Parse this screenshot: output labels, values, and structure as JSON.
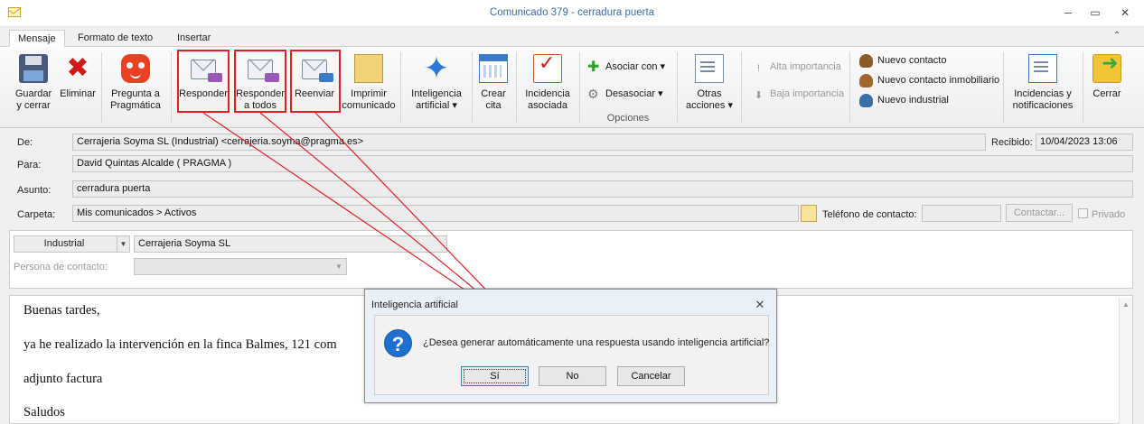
{
  "window": {
    "title": "Comunicado 379 - cerradura puerta",
    "controls": {
      "minimize": "─",
      "restore": "▭",
      "close": "✕"
    }
  },
  "tabs": [
    "Mensaje",
    "Formato de texto",
    "Insertar"
  ],
  "ribbon": {
    "buttons": {
      "guardar": "Guardar\ny cerrar",
      "eliminar": "Eliminar",
      "pregunta": "Pregunta a\nPragmática",
      "responder": "Responder",
      "responder_todos": "Responder\na todos",
      "reenviar": "Reenviar",
      "imprimir": "Imprimir\ncomunicado",
      "ia": "Inteligencia\nartificial ▾",
      "crear_cita": "Crear\ncita",
      "incidencia": "Incidencia\nasociada",
      "otras": "Otras\nacciones ▾",
      "incidencias_notif": "Incidencias y\nnotificaciones",
      "cerrar": "Cerrar"
    },
    "small": {
      "asociar": "Asociar con ▾",
      "desasociar": "Desasociar ▾",
      "alta": "Alta importancia",
      "baja": "Baja importancia",
      "nuevo_contacto": "Nuevo contacto",
      "nuevo_inmob": "Nuevo contacto inmobiliario",
      "nuevo_industrial": "Nuevo industrial"
    },
    "group_label": "Opciones"
  },
  "form": {
    "de_label": "De:",
    "de_value": "Cerrajeria Soyma SL (Industrial) <cerrajeria.soyma@pragma.es>",
    "recibido_label": "Recibido:",
    "recibido_value": "10/04/2023 13:06",
    "para_label": "Para:",
    "para_value": "David Quintas Alcalde ( PRAGMA )",
    "asunto_label": "Asunto:",
    "asunto_value": "cerradura puerta",
    "carpeta_label": "Carpeta:",
    "carpeta_value": "Mis comunicados > Activos",
    "telefono_label": "Teléfono de contacto:",
    "telefono_value": "",
    "contactar_label": "Contactar...",
    "privado_label": "Privado",
    "tipo_value": "Industrial",
    "empresa_value": "Cerrajeria Soyma SL",
    "persona_label": "Persona de contacto:",
    "persona_value": ""
  },
  "body": {
    "lines": [
      "Buenas tardes,",
      "ya he realizado la intervención en la finca Balmes, 121 com",
      "adjunto factura",
      "Saludos"
    ]
  },
  "dialog": {
    "title": "Inteligencia artificial",
    "message": "¿Desea generar automáticamente una respuesta usando inteligencia artificial?",
    "buttons": {
      "si": "Sí",
      "no": "No",
      "cancelar": "Cancelar"
    }
  },
  "colors": {
    "highlight": "#e31e24",
    "title_text": "#3a6ea5",
    "dialog_icon": "#1f6fcf"
  }
}
